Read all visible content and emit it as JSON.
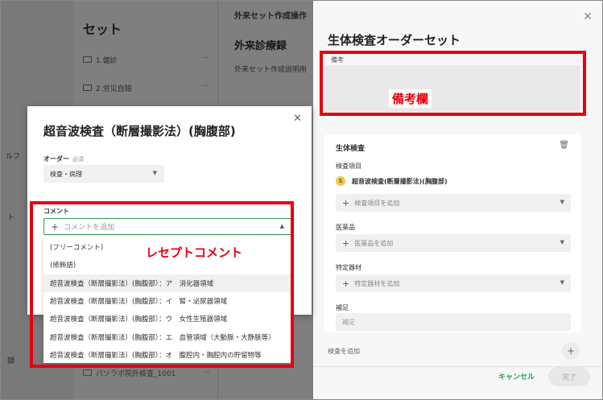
{
  "background": {
    "set_panel": {
      "title": "セット",
      "items": [
        {
          "label": "1.健診"
        },
        {
          "label": "2.労災自賠"
        }
      ],
      "bottom_item": "パソラボ院外検査_1001"
    },
    "middle": {
      "top_text": "外来セット作成操作",
      "heading": "外来診療録",
      "desc": "外来セット作成説明用"
    },
    "edge_labels": [
      "ルフ",
      "ト",
      "録"
    ]
  },
  "drawer": {
    "title": "生体検査オーダーセット",
    "memo_label": "備考",
    "card": {
      "title": "生体検査",
      "exam_items_label": "検査項目",
      "exam_item": {
        "badge": "S",
        "name": "超音波検査(断層撮影法)(胸腹部)"
      },
      "add_exam_item": "検査項目を追加",
      "drug_label": "医薬品",
      "add_drug": "医薬品を追加",
      "device_label": "特定器材",
      "add_device": "特定器材を追加",
      "supplement_label": "補足",
      "supplement_placeholder": "補足"
    },
    "add_exam": "検査を追加",
    "cancel": "キャンセル",
    "done": "完了"
  },
  "modal": {
    "title": "超音波検査（断層撮影法）(胸腹部)",
    "order_label": "オーダー",
    "order_required": "必須",
    "order_value": "検査・病理",
    "comment_label": "コメント",
    "comment_placeholder": "コメントを追加",
    "options": [
      "(フリーコメント)",
      "(修飾語)",
      "超音波検査（断層撮影法）(胸腹部）：ア　消化器領域",
      "超音波検査（断層撮影法）(胸腹部）：イ　腎・泌尿器領域",
      "超音波検査（断層撮影法）(胸腹部）：ウ　女性生殖器領域",
      "超音波検査（断層撮影法）(胸腹部）：エ　血管領域（大動脈・大静脈等）",
      "超音波検査（断層撮影法）(胸腹部）：オ　腹腔内・胸腔内の貯留物等"
    ]
  },
  "annotations": {
    "memo_callout": "備考欄",
    "receipt_callout": "レセプトコメント",
    "color": "#e60012"
  },
  "colors": {
    "accent": "#2d9b55",
    "annotation": "#e60012"
  },
  "icons": {
    "close": "close-icon",
    "trash": "trash-icon",
    "folder": "folder-icon",
    "plus": "plus-icon",
    "caret": "chevron-down-icon"
  }
}
